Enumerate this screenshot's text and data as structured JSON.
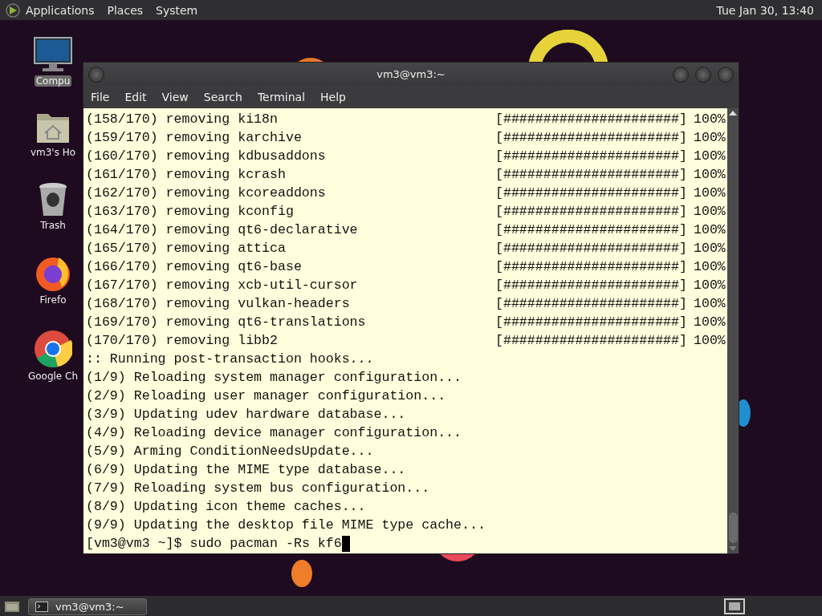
{
  "top_panel": {
    "menus": [
      "Applications",
      "Places",
      "System"
    ],
    "clock": "Tue Jan 30, 13:40"
  },
  "desktop_icons": [
    {
      "kind": "computer",
      "label": "Compu",
      "selected": true
    },
    {
      "kind": "home",
      "label": "vm3's Ho",
      "selected": false
    },
    {
      "kind": "trash",
      "label": "Trash",
      "selected": false
    },
    {
      "kind": "firefox",
      "label": "Firefo",
      "selected": false
    },
    {
      "kind": "chrome",
      "label": "Google Ch",
      "selected": false
    }
  ],
  "window": {
    "title": "vm3@vm3:~",
    "menu": [
      "File",
      "Edit",
      "View",
      "Search",
      "Terminal",
      "Help"
    ],
    "lines": [
      {
        "kind": "progress",
        "text": "(158/170) removing ki18n",
        "bar": "[######################]",
        "percent": "100%"
      },
      {
        "kind": "progress",
        "text": "(159/170) removing karchive",
        "bar": "[######################]",
        "percent": "100%"
      },
      {
        "kind": "progress",
        "text": "(160/170) removing kdbusaddons",
        "bar": "[######################]",
        "percent": "100%"
      },
      {
        "kind": "progress",
        "text": "(161/170) removing kcrash",
        "bar": "[######################]",
        "percent": "100%"
      },
      {
        "kind": "progress",
        "text": "(162/170) removing kcoreaddons",
        "bar": "[######################]",
        "percent": "100%"
      },
      {
        "kind": "progress",
        "text": "(163/170) removing kconfig",
        "bar": "[######################]",
        "percent": "100%"
      },
      {
        "kind": "progress",
        "text": "(164/170) removing qt6-declarative",
        "bar": "[######################]",
        "percent": "100%"
      },
      {
        "kind": "progress",
        "text": "(165/170) removing attica",
        "bar": "[######################]",
        "percent": "100%"
      },
      {
        "kind": "progress",
        "text": "(166/170) removing qt6-base",
        "bar": "[######################]",
        "percent": "100%"
      },
      {
        "kind": "progress",
        "text": "(167/170) removing xcb-util-cursor",
        "bar": "[######################]",
        "percent": "100%"
      },
      {
        "kind": "progress",
        "text": "(168/170) removing vulkan-headers",
        "bar": "[######################]",
        "percent": "100%"
      },
      {
        "kind": "progress",
        "text": "(169/170) removing qt6-translations",
        "bar": "[######################]",
        "percent": "100%"
      },
      {
        "kind": "progress",
        "text": "(170/170) removing libb2",
        "bar": "[######################]",
        "percent": "100%"
      },
      {
        "kind": "text",
        "text": ":: Running post-transaction hooks..."
      },
      {
        "kind": "text",
        "text": "(1/9) Reloading system manager configuration..."
      },
      {
        "kind": "text",
        "text": "(2/9) Reloading user manager configuration..."
      },
      {
        "kind": "text",
        "text": "(3/9) Updating udev hardware database..."
      },
      {
        "kind": "text",
        "text": "(4/9) Reloading device manager configuration..."
      },
      {
        "kind": "text",
        "text": "(5/9) Arming ConditionNeedsUpdate..."
      },
      {
        "kind": "text",
        "text": "(6/9) Updating the MIME type database..."
      },
      {
        "kind": "text",
        "text": "(7/9) Reloading system bus configuration..."
      },
      {
        "kind": "text",
        "text": "(8/9) Updating icon theme caches..."
      },
      {
        "kind": "text",
        "text": "(9/9) Updating the desktop file MIME type cache..."
      },
      {
        "kind": "prompt",
        "prompt": "[vm3@vm3 ~]$",
        "command": "sudo pacman -Rs kf6"
      }
    ]
  },
  "taskbar": {
    "tasks": [
      {
        "label": "vm3@vm3:~",
        "selected": true
      }
    ]
  }
}
